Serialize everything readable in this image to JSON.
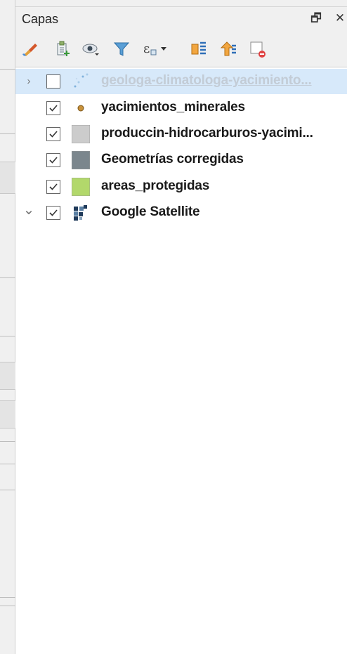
{
  "panel": {
    "title": "Capas",
    "float_icon": "restore-icon",
    "float_glyph": "🗗",
    "close_icon": "close-icon",
    "close_glyph": "✕"
  },
  "toolbar": [
    {
      "name": "style-manager-icon"
    },
    {
      "name": "add-group-icon"
    },
    {
      "name": "manage-map-themes-icon"
    },
    {
      "name": "filter-legend-icon"
    },
    {
      "name": "filter-by-expression-icon"
    },
    {
      "name": "expand-all-icon"
    },
    {
      "name": "collapse-all-icon"
    },
    {
      "name": "remove-layer-icon"
    }
  ],
  "layers": [
    {
      "label": "geologa-climatologa-yacimiento...",
      "checked": false,
      "expander": "›",
      "symbol": "point-cloud",
      "dimmed": true,
      "selected": true
    },
    {
      "label": "yacimientos_minerales",
      "checked": true,
      "expander": "",
      "symbol": "dot",
      "color": "#c8913a"
    },
    {
      "label": "produccin-hidrocarburos-yacimi...",
      "checked": true,
      "expander": "",
      "symbol": "square",
      "color": "#cccccc"
    },
    {
      "label": "Geometrías corregidas",
      "checked": true,
      "expander": "",
      "symbol": "square",
      "color": "#7b868d"
    },
    {
      "label": "areas_protegidas",
      "checked": true,
      "expander": "",
      "symbol": "square",
      "color": "#b2d86b"
    },
    {
      "label": "Google Satellite",
      "checked": true,
      "expander": "⌄",
      "symbol": "raster"
    }
  ]
}
